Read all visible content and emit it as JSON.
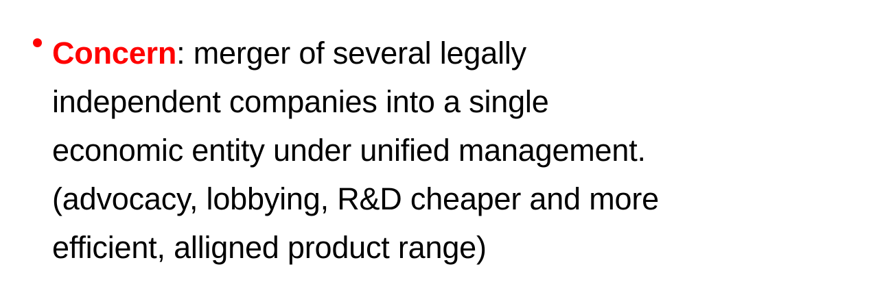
{
  "slide": {
    "bullet": {
      "term": "Concern",
      "separator": ": ",
      "lines": [
        "merger of several legally",
        "independent companies into a single",
        "economic entity under unified management.",
        "(advocacy, lobbying, R&D cheaper and more",
        "efficient, alligned product range)"
      ],
      "accent_color": "#ff0000"
    }
  }
}
